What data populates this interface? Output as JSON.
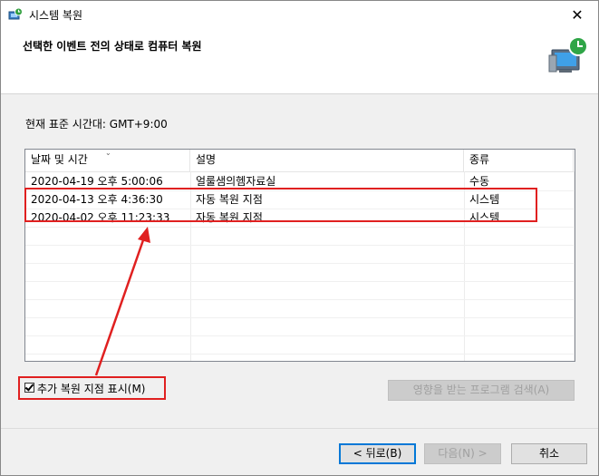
{
  "window": {
    "title": "시스템 복원"
  },
  "header": {
    "title": "선택한 이벤트 전의 상태로 컴퓨터 복원"
  },
  "timezone_label": "현재 표준 시간대: GMT+9:00",
  "table": {
    "columns": [
      "날짜 및 시간",
      "설명",
      "종류"
    ],
    "rows": [
      {
        "datetime": "2020-04-19 오후 5:00:06",
        "description": "얼룰샘의헴자료실",
        "type": "수동"
      },
      {
        "datetime": "2020-04-13 오후 4:36:30",
        "description": "자동 복원 지점",
        "type": "시스템"
      },
      {
        "datetime": "2020-04-02 오후 11:23:33",
        "description": "자동 복원 지점",
        "type": "시스템"
      }
    ]
  },
  "checkbox": {
    "label": "추가 복원 지점 표시(M)",
    "checked": true
  },
  "buttons": {
    "scan": "영향을 받는 프로그램 검색(A)",
    "back": "< 뒤로(B)",
    "next": "다음(N) >",
    "cancel": "취소"
  },
  "icons": {
    "title": "system-restore-icon",
    "header": "system-restore-computer-icon",
    "close": "close-icon"
  },
  "colors": {
    "highlight": "#e02020",
    "focus": "#0078d7"
  }
}
